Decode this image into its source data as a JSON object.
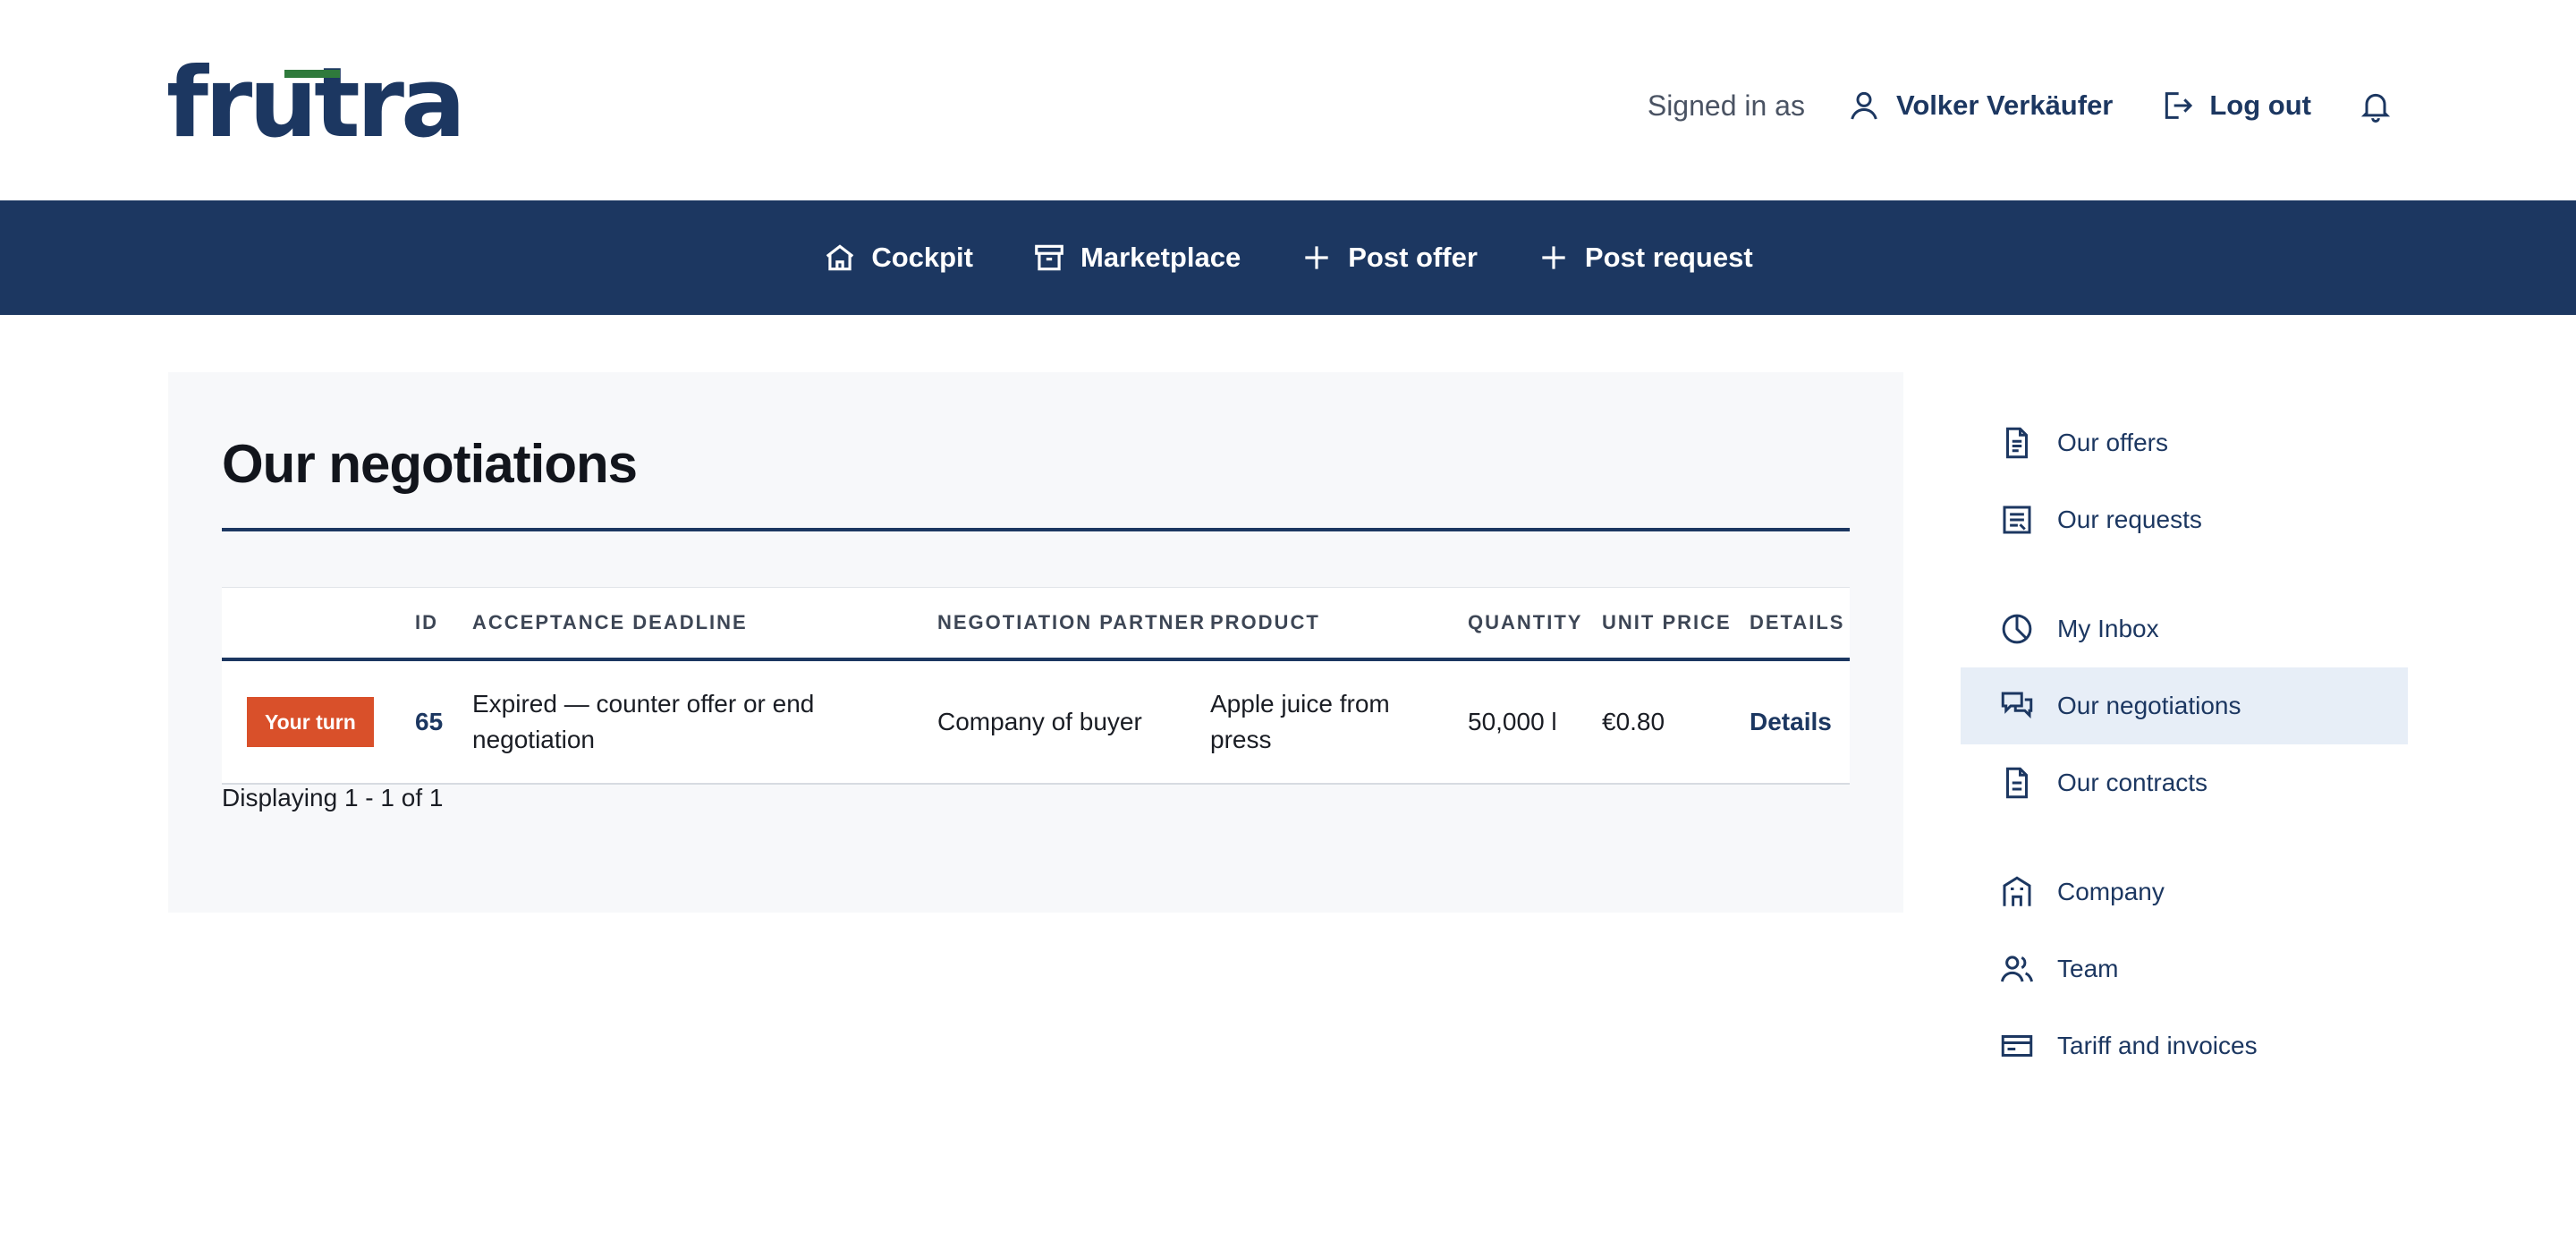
{
  "brand": {
    "logo_text": "frutra",
    "bar_color": "#2f7a3c",
    "text_color": "#1c3761"
  },
  "header": {
    "signed_in_label": "Signed in as",
    "user_name": "Volker Verkäufer",
    "user_icon": "user-icon",
    "logout_label": "Log out",
    "logout_icon": "logout-icon",
    "notification_icon": "bell-icon"
  },
  "nav": {
    "items": [
      {
        "label": "Cockpit",
        "icon": "home-icon"
      },
      {
        "label": "Marketplace",
        "icon": "archive-box-icon"
      },
      {
        "label": "Post offer",
        "icon": "plus-icon"
      },
      {
        "label": "Post request",
        "icon": "plus-icon"
      }
    ],
    "background": "#1c3761"
  },
  "main": {
    "title": "Our negotiations",
    "table": {
      "headers": [
        "",
        "ID",
        "ACCEPTANCE DEADLINE",
        "NEGOTIATION PARTNER",
        "PRODUCT",
        "QUANTITY",
        "UNIT PRICE",
        "DETAILS"
      ],
      "rows": [
        {
          "status": "Your turn",
          "id": "65",
          "deadline": "Expired — counter offer or end negotiation",
          "partner": "Company of buyer",
          "product": "Apple juice from press",
          "quantity": "50,000 l",
          "unit_price": "€0.80",
          "details": "Details"
        }
      ]
    },
    "pagination": "Displaying 1 - 1 of 1",
    "status_color": "#d9502a"
  },
  "sidebar": {
    "items": [
      {
        "label": "Our offers",
        "icon": "document-icon"
      },
      {
        "label": "Our requests",
        "icon": "list-document-icon"
      },
      {
        "label": "My Inbox",
        "icon": "clock-icon"
      },
      {
        "label": "Our negotiations",
        "icon": "chat-bubbles-icon",
        "active": true
      },
      {
        "label": "Our contracts",
        "icon": "contract-icon"
      },
      {
        "label": "Company",
        "icon": "building-icon"
      },
      {
        "label": "Team",
        "icon": "team-icon"
      },
      {
        "label": "Tariff and invoices",
        "icon": "credit-card-icon"
      }
    ],
    "active_background": "#e7eef7"
  }
}
